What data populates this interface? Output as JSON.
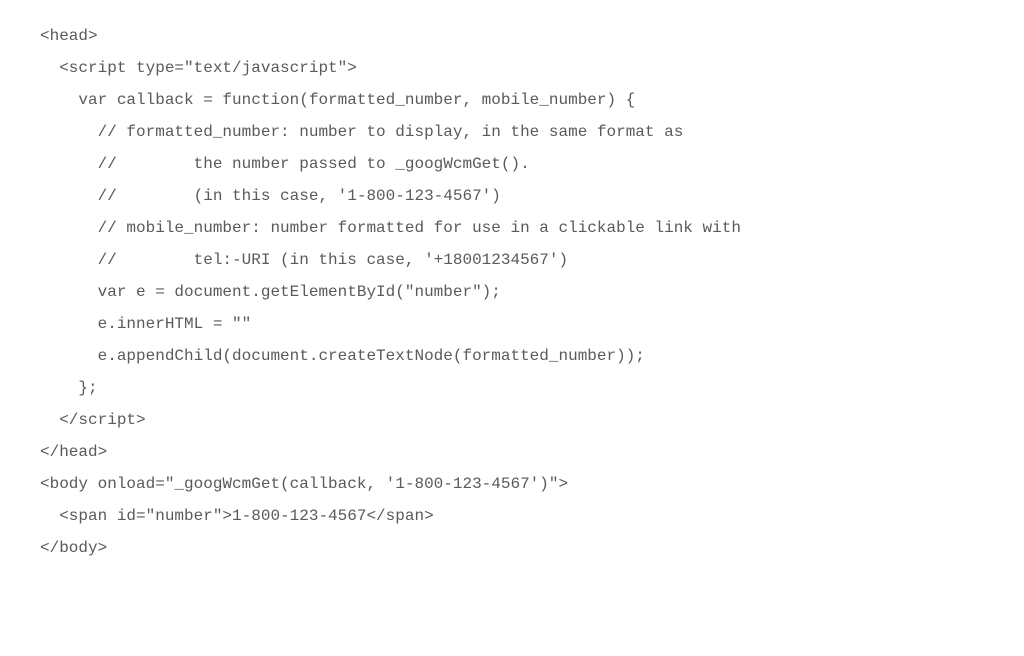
{
  "code": {
    "lines": [
      {
        "indent": 0,
        "text": "<head>"
      },
      {
        "indent": 1,
        "text": "<script type=\"text/javascript\">"
      },
      {
        "indent": 2,
        "text": "var callback = function(formatted_number, mobile_number) {"
      },
      {
        "indent": 3,
        "text": "// formatted_number: number to display, in the same format as"
      },
      {
        "indent": 3,
        "text": "//        the number passed to _googWcmGet()."
      },
      {
        "indent": 3,
        "text": "//        (in this case, '1-800-123-4567')"
      },
      {
        "indent": 3,
        "text": "// mobile_number: number formatted for use in a clickable link with"
      },
      {
        "indent": 3,
        "text": "//        tel:-URI (in this case, '+18001234567')"
      },
      {
        "indent": 3,
        "text": "var e = document.getElementById(\"number\");"
      },
      {
        "indent": 3,
        "text": "e.innerHTML = \"\""
      },
      {
        "indent": 3,
        "text": "e.appendChild(document.createTextNode(formatted_number));"
      },
      {
        "indent": 2,
        "text": "};"
      },
      {
        "indent": 1,
        "text": "</script>"
      },
      {
        "indent": 0,
        "text": "</head>"
      },
      {
        "indent": 0,
        "text": "<body onload=\"_googWcmGet(callback, '1-800-123-4567')\">"
      },
      {
        "indent": 1,
        "text": "<span id=\"number\">1-800-123-4567</span>"
      },
      {
        "indent": 0,
        "text": "</body>"
      }
    ]
  }
}
